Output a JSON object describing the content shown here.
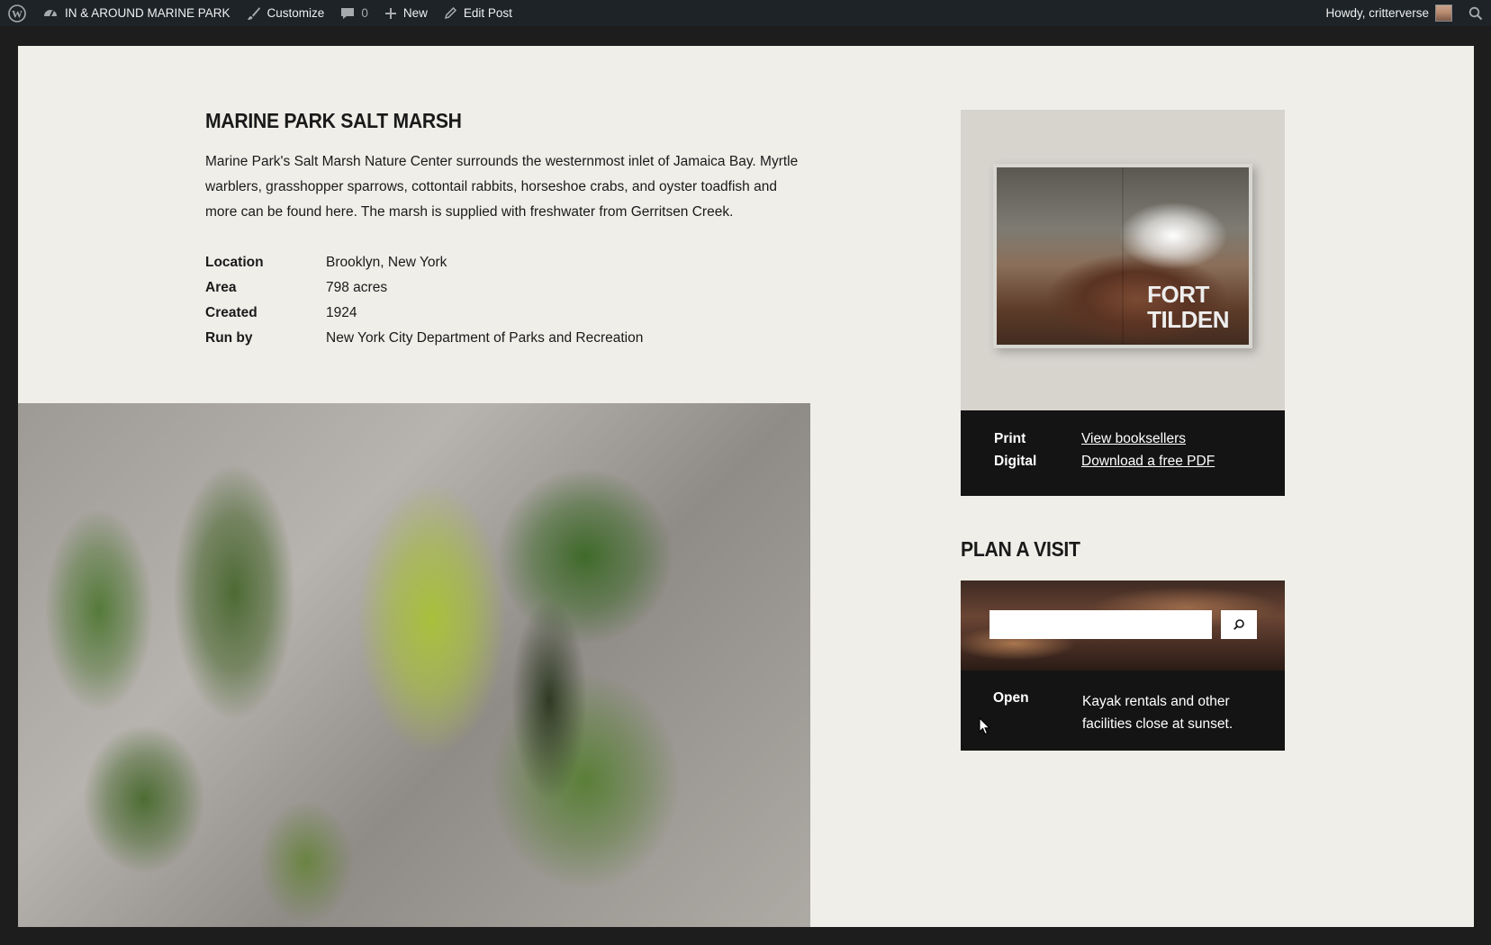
{
  "adminbar": {
    "site_name": "IN & AROUND MARINE PARK",
    "customize_label": "Customize",
    "comments_count": "0",
    "new_label": "New",
    "edit_label": "Edit Post",
    "greeting": "Howdy, critterverse"
  },
  "post": {
    "title": "MARINE PARK SALT MARSH",
    "description": "Marine Park's Salt Marsh Nature Center surrounds the westernmost inlet of Jamaica Bay. Myrtle warblers, grasshopper sparrows, cottontail rabbits, horseshoe crabs, and oyster toadfish and more can be found here. The marsh is supplied with freshwater from Gerritsen Creek.",
    "facts": [
      {
        "label": "Location",
        "value": "Brooklyn, New York"
      },
      {
        "label": "Area",
        "value": "798 acres"
      },
      {
        "label": "Created",
        "value": "1924"
      },
      {
        "label": "Run by",
        "value": "New York City Department of Parks and Recreation"
      }
    ]
  },
  "book": {
    "cover_line1": "FORT",
    "cover_line2": "TILDEN",
    "print_label": "Print",
    "print_link": "View booksellers",
    "digital_label": "Digital",
    "digital_link": "Download a free PDF"
  },
  "visit": {
    "title": "PLAN A VISIT",
    "search_value": "",
    "open_label": "Open",
    "open_text": "Kayak rentals and other facilities close at sunset."
  },
  "colors": {
    "page_bg": "#efeee9",
    "frame": "#1d1d1d",
    "adminbar": "#1d2327",
    "dark_box": "#141414"
  }
}
